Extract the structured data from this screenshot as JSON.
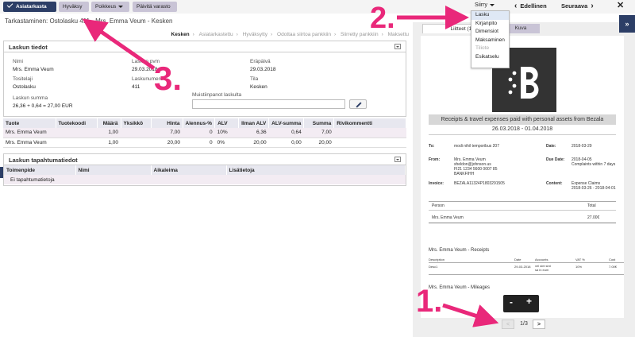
{
  "toolbar": {
    "asiatarkasta": "Asiatarkasta",
    "hyvaksy": "Hyväksy",
    "poikkeus": "Poikkeus",
    "paivita_varasto": "Päivitä varasto",
    "siirry": "Siirry",
    "edellinen": "Edellinen",
    "seuraava": "Seuraava",
    "close": "✕"
  },
  "goto_menu": [
    "Lasku",
    "Kirjanpito",
    "Dimensiot",
    "Maksaminen",
    "Tiliote",
    "Esikatselu"
  ],
  "title": "Tarkastaminen: Ostolasku 411 - Mrs. Emma Veum - Kesken",
  "steps": [
    "Kesken",
    "Asiatarkastettu",
    "Hyväksytty",
    "Odottaa siirtoa pankkiin",
    "Siirretty pankkiin",
    "Maksettu"
  ],
  "invoice_info": {
    "header": "Laskun tiedot",
    "nimi_label": "Nimi",
    "nimi": "Mrs. Emma Veum",
    "pvm_label": "Laskun pvm",
    "pvm": "29.03.2018",
    "erapaiva_label": "Eräpäivä",
    "erapaiva": "29.03.2018",
    "tositelaji_label": "Tositelaji",
    "tositelaji": "Ostolasku",
    "laskunumero_label": "Laskunumero",
    "laskunumero": "411",
    "tila_label": "Tila",
    "tila": "Kesken",
    "summa_label": "Laskun summa",
    "summa": "26,36 + 0,64 = 27,00 EUR",
    "muistiinpanot_label": "Muistiinpanot laskulta"
  },
  "rows_table": {
    "headers": [
      "Tuote",
      "Tuotekoodi",
      "Määrä",
      "Yksikkö",
      "Hinta",
      "Alennus-%",
      "ALV",
      "Ilman ALV",
      "ALV-summa",
      "Summa",
      "Rivikommentti"
    ],
    "rows": [
      [
        "Mrs. Emma Veum",
        "",
        "1,00",
        "",
        "7,00",
        "0",
        "10%",
        "6,36",
        "0,64",
        "7,00",
        ""
      ],
      [
        "Mrs. Emma Veum",
        "",
        "1,00",
        "",
        "20,00",
        "0",
        "0%",
        "20,00",
        "0,00",
        "20,00",
        ""
      ]
    ]
  },
  "events": {
    "header": "Laskun tapahtumatiedot",
    "headers": [
      "Toimenpide",
      "Nimi",
      "Aikaleima",
      "Lisätietoja"
    ],
    "empty": "Ei tapahtumatietoja"
  },
  "viewer": {
    "tab_liitteet": "Liitteet (1)",
    "tab_kuva": "Kuva",
    "doc_title": "Receipts & travel expenses paid with personal assets from Bezala",
    "doc_period": "26.03.2018 - 01.04.2018",
    "to_label": "To:",
    "to": "modi nihil temporibus 207",
    "date_label": "Date:",
    "date": "2018-03-29",
    "from_label": "From:",
    "from_1": "Mrs. Emma Veum",
    "from_2": "sheldon@johnson.us",
    "from_3": "FI21 1234 5600 0007 85",
    "from_4": "BANKFIHH",
    "due_label": "Due Date:",
    "due": "2018-04-05",
    "due_note": "Complaints within 7 days",
    "invoice_label": "Invoice:",
    "invoice": "BEZALA11324P1803291505",
    "content_label": "Content:",
    "content_1": "Expense Claims",
    "content_2": "2018-03-26 - 2018-04-01",
    "person_h": "Person",
    "total_h": "Total",
    "person": "Mrs. Emma Veum",
    "total": "27.00€",
    "receipts_title": "Mrs. Emma Veum - Receipts",
    "receipts_headers": [
      "Description",
      "Date",
      "Accounts",
      "VAT %",
      "Cost"
    ],
    "receipt_row": [
      "Desc1",
      "29-03-2018",
      "vel sint sint\nsa in eum",
      "10%",
      "7.00€"
    ],
    "mileages_title": "Mrs. Emma Veum - Mileages",
    "zoom_out": "-",
    "zoom_in": "+",
    "pager": "1/3",
    "prev": "<",
    "next": ">",
    "collapse": "»"
  },
  "annotations": [
    "1.",
    "2.",
    "3."
  ],
  "colors": {
    "accent": "#2c3e66",
    "annotation": "#e9287a"
  }
}
